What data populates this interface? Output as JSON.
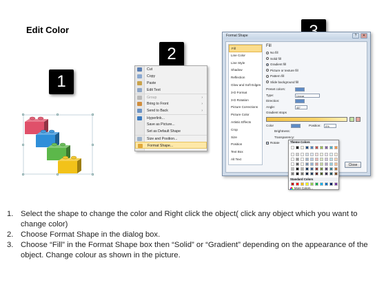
{
  "title": "Edit Color",
  "steps": {
    "one": "1",
    "two": "2",
    "three": "3"
  },
  "context_menu": {
    "items": [
      {
        "label": "Cut",
        "icon": "scissors-icon",
        "color": "#5b7fb3"
      },
      {
        "label": "Copy",
        "icon": "copy-icon",
        "color": "#8aa8d0"
      },
      {
        "label": "Paste",
        "icon": "paste-icon",
        "color": "#c9a24a"
      },
      {
        "label": "Edit Text",
        "icon": "edit-text-icon",
        "color": "#8ea6c6"
      },
      {
        "label": "Group",
        "icon": "group-icon",
        "color": "#b9b9b9",
        "disabled": true,
        "submenu": true
      },
      {
        "label": "Bring to Front",
        "icon": "bring-front-icon",
        "color": "#d08d3c",
        "submenu": true
      },
      {
        "label": "Send to Back",
        "icon": "send-back-icon",
        "color": "#6c93c4",
        "submenu": true
      },
      {
        "label": "Hyperlink...",
        "icon": "hyperlink-icon",
        "color": "#3c7bc0"
      },
      {
        "label": "Save as Picture...",
        "icon": "",
        "color": ""
      },
      {
        "label": "Set as Default Shape",
        "icon": "",
        "color": ""
      },
      {
        "label": "Size and Position...",
        "icon": "size-position-icon",
        "color": "#9bb0c8"
      },
      {
        "label": "Format Shape...",
        "icon": "format-shape-icon",
        "color": "#e2a93b",
        "highlighted": true
      }
    ]
  },
  "format_dialog": {
    "title": "Format Shape",
    "nav": [
      "Fill",
      "Line Color",
      "Line Style",
      "Shadow",
      "Reflection",
      "Glow and Soft Edges",
      "3-D Format",
      "3-D Rotation",
      "Picture Corrections",
      "Picture Color",
      "Artistic Effects",
      "Crop",
      "Size",
      "Position",
      "Text Box",
      "Alt Text"
    ],
    "heading": "Fill",
    "options": [
      {
        "label": "No fill",
        "selected": false
      },
      {
        "label": "Solid fill",
        "selected": false
      },
      {
        "label": "Gradient fill",
        "selected": true
      },
      {
        "label": "Picture or texture fill",
        "selected": false
      },
      {
        "label": "Pattern fill",
        "selected": false
      },
      {
        "label": "Slide background fill",
        "selected": false
      }
    ],
    "preset_label": "Preset colors:",
    "type_label": "Type:",
    "type_value": "Linear",
    "direction_label": "Direction:",
    "angle_label": "Angle:",
    "angle_value": "45°",
    "stops_label": "Gradient stops",
    "color_label": "Color",
    "position_label": "Position:",
    "position_value": "0%",
    "brightness_label": "Brightness:",
    "transparency_label": "Transparency:",
    "rotate_label": "Rotate",
    "close_label": "Close"
  },
  "palette": {
    "theme_label": "Theme Colors",
    "standard_label": "Standard Colors",
    "more_label": "More Colors...",
    "theme_top": [
      "#ffffff",
      "#000000",
      "#eeece1",
      "#1f497d",
      "#4f81bd",
      "#c0504d",
      "#9bbb59",
      "#8064a2",
      "#4bacc6",
      "#f79646"
    ],
    "standard": [
      "#c00000",
      "#ff0000",
      "#ffc000",
      "#ffff00",
      "#92d050",
      "#00b050",
      "#00b0f0",
      "#0070c0",
      "#002060",
      "#7030a0"
    ]
  },
  "instructions": [
    {
      "num": "1.",
      "text": "Select the shape to change the color and Right click the object( click any object which you want to change color)"
    },
    {
      "num": "2.",
      "text": "Choose Format Shape in the dialog box."
    },
    {
      "num": "3.",
      "text": "Choose “Fill” in the Format Shape box then “Solid” or “Gradient” depending on the appearance of the object. Change colour as shown in the picture."
    }
  ],
  "lego_colors": [
    "#e0506a",
    "#2f8fd9",
    "#5cb84a",
    "#f2c21a"
  ]
}
